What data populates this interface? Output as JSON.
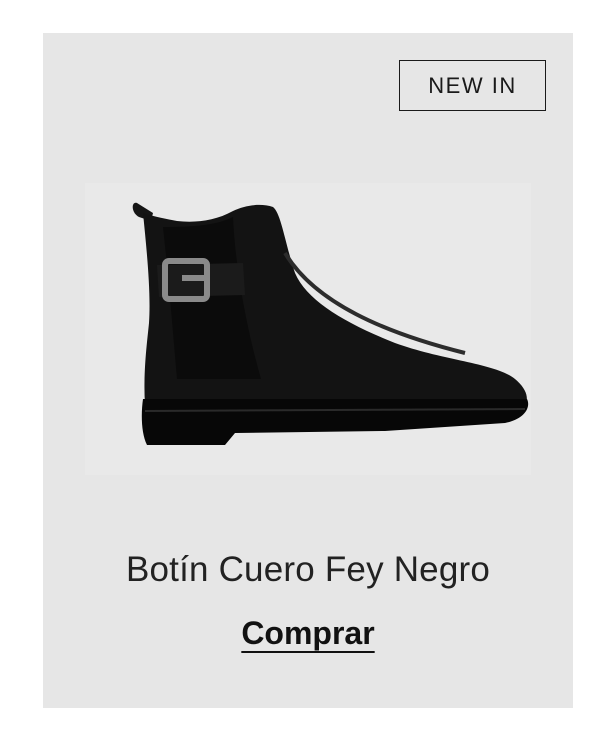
{
  "card": {
    "badge_label": "NEW IN",
    "product_name": "Botín Cuero Fey Negro",
    "cta_label": "Comprar",
    "image_icon": "black-leather-chelsea-ankle-boot-with-buckle"
  },
  "colors": {
    "card_background": "#e6e6e6",
    "text": "#222222",
    "boot": "#111111"
  }
}
